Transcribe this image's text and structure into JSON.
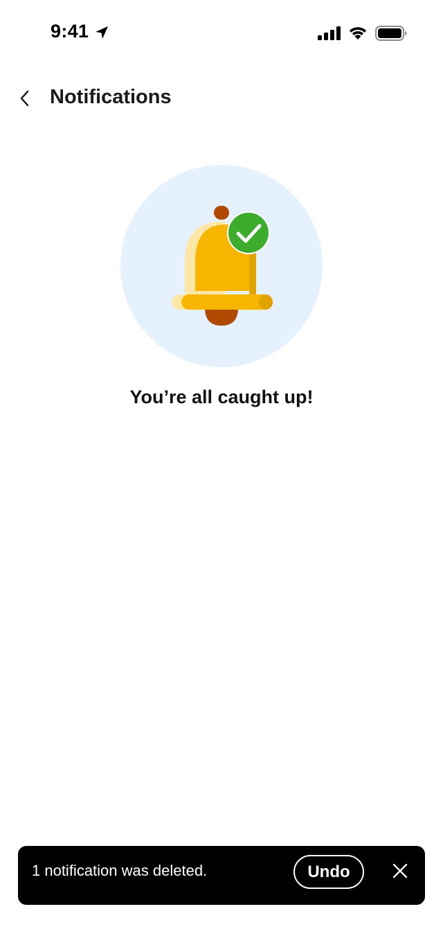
{
  "status_bar": {
    "time": "9:41",
    "icons": [
      "location-arrow-icon",
      "cellular-signal-icon",
      "wifi-icon",
      "battery-icon"
    ]
  },
  "header": {
    "back_icon": "chevron-left-icon",
    "title": "Notifications"
  },
  "empty_state": {
    "illustration_icon": "bell-with-check-icon",
    "message": "You’re all caught up!"
  },
  "snackbar": {
    "message": "1 notification was deleted.",
    "undo_label": "Undo",
    "close_icon": "close-icon"
  },
  "colors": {
    "illustration_background": "#e5f2fd",
    "bell_yellow": "#f7b500",
    "bell_highlight": "#fde7a6",
    "bell_clapper": "#b04a00",
    "check_green": "#3dab2c",
    "snackbar_background": "#000000"
  }
}
